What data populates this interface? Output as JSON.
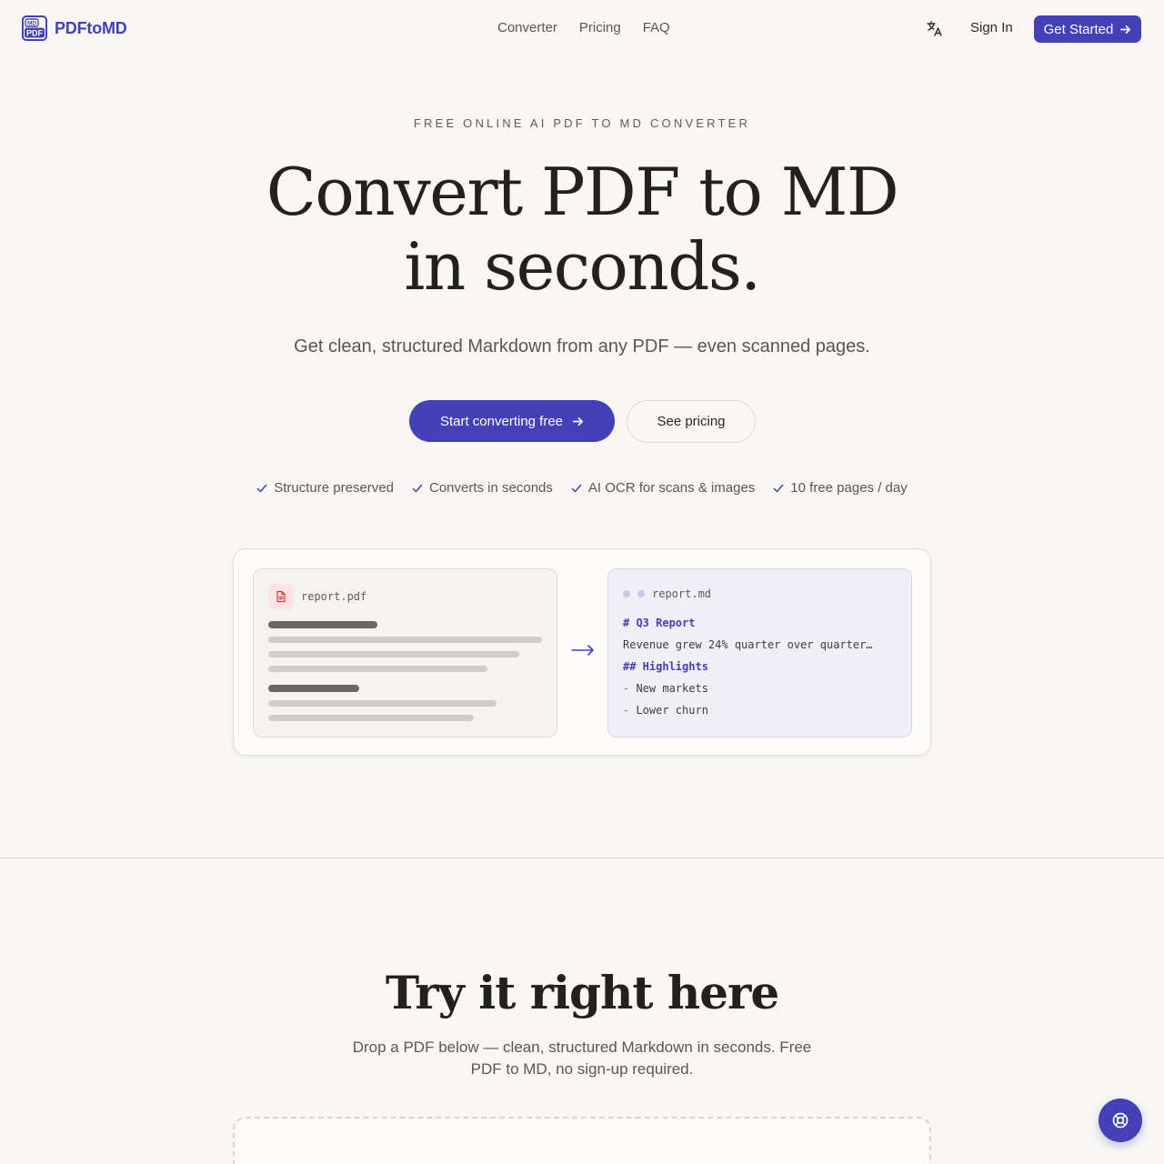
{
  "header": {
    "logo_text": "PDFtoMD",
    "logo_badge_top": "MD",
    "logo_badge_bottom": "PDF",
    "nav": [
      "Converter",
      "Pricing",
      "FAQ"
    ],
    "sign_in": "Sign In",
    "get_started": "Get Started"
  },
  "hero": {
    "eyebrow": "FREE ONLINE AI PDF TO MD CONVERTER",
    "title_line1": "Convert PDF to MD",
    "title_line2": "in seconds.",
    "subtitle": "Get clean, structured Markdown from any PDF — even scanned pages.",
    "primary_cta": "Start converting free",
    "secondary_cta": "See pricing",
    "features": [
      "Structure preserved",
      "Converts in seconds",
      "AI OCR for scans & images",
      "10 free pages / day"
    ]
  },
  "demo": {
    "pdf_filename": "report.pdf",
    "md_filename": "report.md",
    "md_lines": [
      {
        "text": "# Q3 Report",
        "kind": "heading"
      },
      {
        "text": "Revenue grew 24% quarter over quarter…",
        "kind": "text"
      },
      {
        "text": "## Highlights",
        "kind": "heading"
      },
      {
        "text": "New markets",
        "kind": "bullet"
      },
      {
        "text": "Lower churn",
        "kind": "bullet"
      }
    ]
  },
  "try_section": {
    "title": "Try it right here",
    "subtitle": "Drop a PDF below — clean, structured Markdown in seconds. Free PDF to MD, no sign-up required."
  },
  "colors": {
    "accent": "#4340b8",
    "background": "#f8f7f4",
    "pdf_icon_red": "#d43b3b"
  },
  "icons": {
    "language": "translate-icon",
    "arrow": "arrow-right-icon",
    "check": "check-icon",
    "pdf": "file-text-icon",
    "help": "lifebuoy-icon"
  }
}
